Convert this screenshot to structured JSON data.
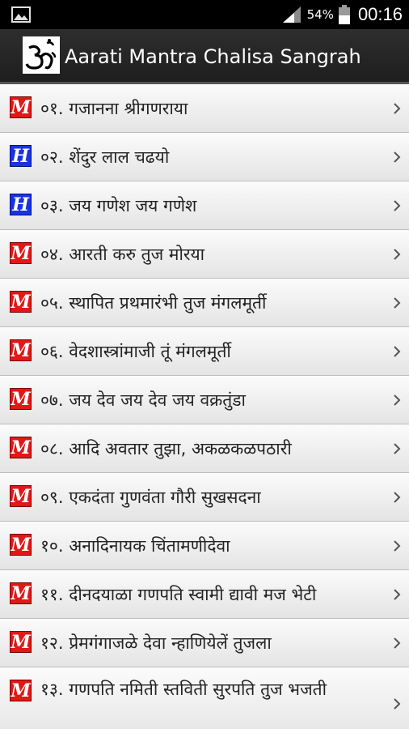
{
  "status_bar": {
    "battery_percent": "54%",
    "time": "00:16",
    "icons": [
      "picture-icon",
      "signal-icon",
      "battery-icon"
    ]
  },
  "action_bar": {
    "title": "Aarati Mantra Chalisa Sangrah",
    "icon": "om-icon"
  },
  "colors": {
    "marathi_badge": "#e01818",
    "hindi_badge": "#1a33e0",
    "action_bar": "#262626"
  },
  "list": {
    "items": [
      {
        "badge": "M",
        "label": "०१. गजानना श्रीगणराया"
      },
      {
        "badge": "H",
        "label": "०२. शेंदुर लाल चढयो"
      },
      {
        "badge": "H",
        "label": "०३. जय गणेश जय गणेश"
      },
      {
        "badge": "M",
        "label": "०४. आरती करु तुज मोरया"
      },
      {
        "badge": "M",
        "label": "०५. स्थापित प्रथमारंभी तुज मंगलमूर्ती"
      },
      {
        "badge": "M",
        "label": "०६. वेदशास्त्रांमाजी तूं मंगलमूर्ती"
      },
      {
        "badge": "M",
        "label": "०७. जय देव जय देव जय वक्रतुंडा"
      },
      {
        "badge": "M",
        "label": "०८. आदि अवतार तुझा, अकळकळपठारी"
      },
      {
        "badge": "M",
        "label": "०९. एकदंता गुणवंता गौरी सुखसदना"
      },
      {
        "badge": "M",
        "label": "१०. अनादिनायक चिंतामणीदेवा"
      },
      {
        "badge": "M",
        "label": "११. दीनदयाळा गणपति स्वामी द्यावी मज भेटी"
      },
      {
        "badge": "M",
        "label": "१२. प्रेमगंगाजळे देवा न्हाणियेलें तुजला"
      },
      {
        "badge": "M",
        "label": "१३. गणपति नमिती स्तविती सुरपति तुज भजती"
      }
    ]
  }
}
